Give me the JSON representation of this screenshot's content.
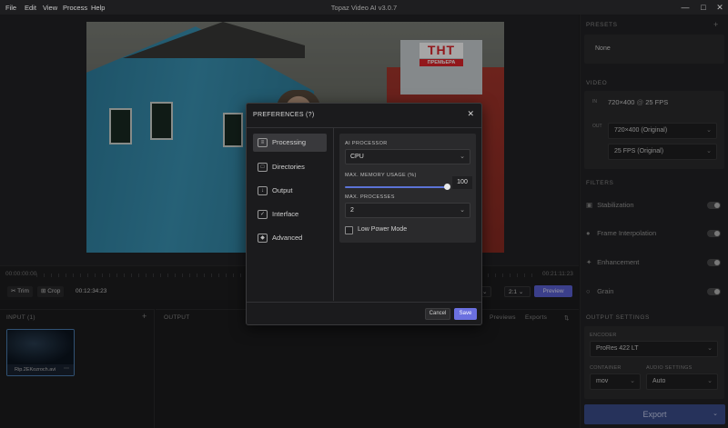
{
  "menu": [
    "File",
    "Edit",
    "View",
    "Process",
    "Help"
  ],
  "window_title": "Topaz Video AI  v3.0.7",
  "video_overlay_logo": {
    "main": "ТНТ",
    "sub": "ПРЕМЬЕРА"
  },
  "timeline": {
    "start": "00:00:00:00",
    "end": "00:21:11:23"
  },
  "toolbar": {
    "trim_label": "Trim",
    "crop_label": "Crop",
    "timecode": "00:12:34:23",
    "zoom_select": "2:1",
    "preview_label": "Preview"
  },
  "input_panel": {
    "title": "INPUT (1)",
    "add_label": "+",
    "file_name": "Rip.2EKozroch.avi"
  },
  "output_panel": {
    "title": "OUTPUT",
    "previews_label": "Previews",
    "exports_label": "Exports"
  },
  "sidebar": {
    "presets_title": "PRESETS",
    "preset_value": "None",
    "video_title": "VIDEO",
    "in_label": "IN",
    "in_res": "720×400",
    "in_at": "@",
    "in_fps": "25 FPS",
    "out_label": "OUT",
    "out_res": "720×400 (Original)",
    "out_fps": "25 FPS (Original)",
    "filters_title": "FILTERS",
    "filters": [
      {
        "label": "Stabilization",
        "enabled": false
      },
      {
        "label": "Frame Interpolation",
        "enabled": false
      },
      {
        "label": "Enhancement",
        "enabled": false
      },
      {
        "label": "Grain",
        "enabled": false
      }
    ],
    "output_settings_title": "OUTPUT SETTINGS",
    "encoder_label": "ENCODER",
    "encoder_value": "ProRes 422 LT",
    "container_label": "CONTAINER",
    "container_value": "mov",
    "audio_label": "AUDIO SETTINGS",
    "audio_value": "Auto",
    "export_label": "Export"
  },
  "modal": {
    "title": "PREFERENCES (?)",
    "nav": [
      {
        "label": "Processing",
        "active": true
      },
      {
        "label": "Directories",
        "active": false
      },
      {
        "label": "Output",
        "active": false
      },
      {
        "label": "Interface",
        "active": false
      },
      {
        "label": "Advanced",
        "active": false
      }
    ],
    "ai_processor_label": "AI PROCESSOR",
    "ai_processor_value": "CPU",
    "memory_label": "MAX. MEMORY USAGE (%)",
    "memory_value": "100",
    "memory_fraction": 1.0,
    "max_processes_label": "MAX. PROCESSES",
    "max_processes_value": "2",
    "low_power_label": "Low Power Mode",
    "low_power_checked": false,
    "cancel_label": "Cancel",
    "save_label": "Save"
  },
  "colors": {
    "accent": "#6b70e0",
    "export": "#3b4e8c",
    "background": "#1c1c1e"
  }
}
